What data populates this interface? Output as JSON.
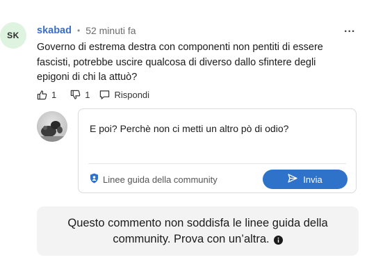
{
  "comment": {
    "avatar_initials": "SK",
    "author": "skabad",
    "separator": "•",
    "timestamp": "52 minuti fa",
    "more_label": "...",
    "body_lines": [
      "Governo di estrema destra con componenti non pentiti di essere",
      "fascisti, potrebbe uscire qualcosa di diverso dallo sfintere degli",
      "epigoni di chi la attuò?"
    ],
    "actions": {
      "like_count": "1",
      "dislike_count": "1",
      "reply_label": "Rispondi"
    }
  },
  "composer": {
    "text": "E poi? Perchè non ci metti un altro pò di odio?",
    "guidelines_label": "Linee guida della community",
    "send_label": "Invia"
  },
  "notice": {
    "line1": "Questo commento non soddisfa le linee guida della",
    "line2": "community. Prova con un’altra."
  },
  "colors": {
    "author": "#3a6ec8",
    "send_button": "#2e72c9",
    "avatar_bg": "#dff3e1",
    "notice_bg": "#f3f3f3"
  },
  "icons": {
    "like": "thumbs-up-icon",
    "dislike": "thumbs-down-icon",
    "reply": "speech-bubble-icon",
    "shield": "shield-icon",
    "send": "paper-plane-icon",
    "info": "info-icon",
    "more": "ellipsis-icon"
  }
}
